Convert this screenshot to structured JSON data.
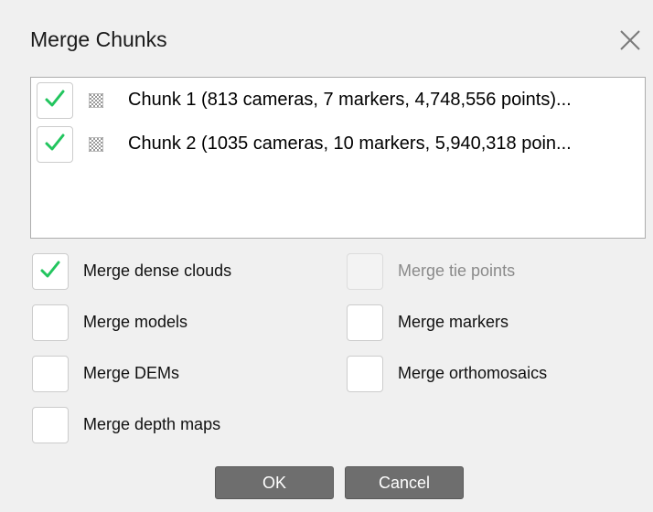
{
  "dialog": {
    "title": "Merge Chunks",
    "close_icon": "close-icon"
  },
  "chunks": [
    {
      "checked": true,
      "icon": "checkerboard-icon",
      "label": "Chunk 1 (813 cameras, 7 markers, 4,748,556 points)..."
    },
    {
      "checked": true,
      "icon": "checkerboard-icon",
      "label": "Chunk 2 (1035 cameras, 10 markers, 5,940,318 poin..."
    }
  ],
  "options": {
    "dense_clouds": {
      "label": "Merge dense clouds",
      "checked": true,
      "enabled": true
    },
    "tie_points": {
      "label": "Merge tie points",
      "checked": false,
      "enabled": false
    },
    "models": {
      "label": "Merge models",
      "checked": false,
      "enabled": true
    },
    "markers": {
      "label": "Merge markers",
      "checked": false,
      "enabled": true
    },
    "dems": {
      "label": "Merge DEMs",
      "checked": false,
      "enabled": true
    },
    "orthomosaics": {
      "label": "Merge orthomosaics",
      "checked": false,
      "enabled": true
    },
    "depth_maps": {
      "label": "Merge depth maps",
      "checked": false,
      "enabled": true
    }
  },
  "buttons": {
    "ok": "OK",
    "cancel": "Cancel"
  },
  "colors": {
    "check": "#22c55e",
    "button_bg": "#6e6e6e",
    "dialog_bg": "#f0f0f0"
  }
}
